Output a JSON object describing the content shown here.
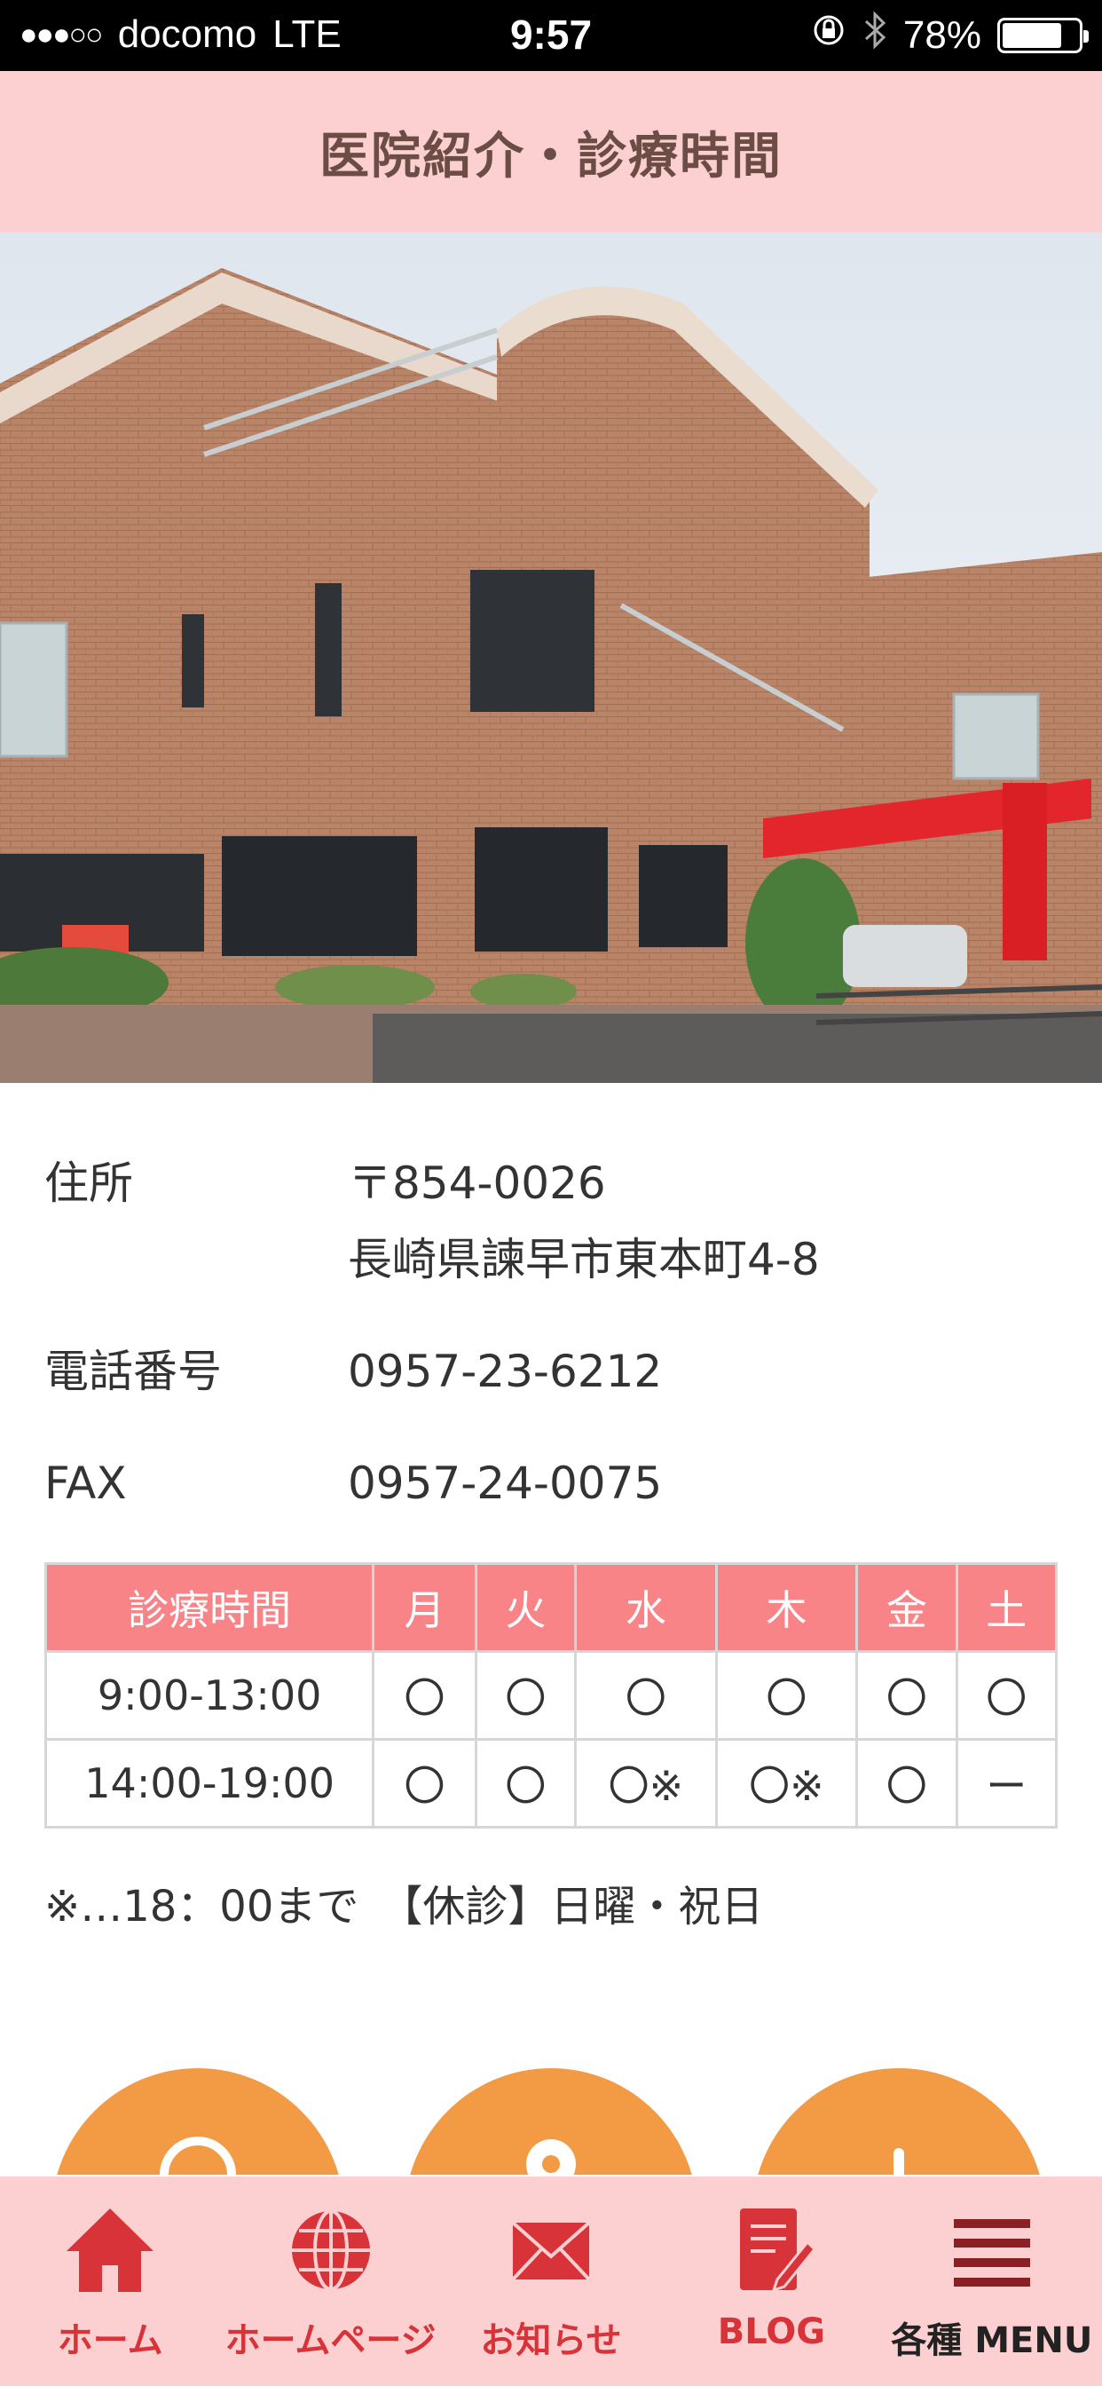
{
  "status_bar": {
    "signal_dots": "●●●○○",
    "carrier": "docomo",
    "network": "LTE",
    "time": "9:57",
    "battery_percent": "78%",
    "battery_level": 0.78
  },
  "header": {
    "title": "医院紹介・診療時間"
  },
  "photo": {
    "icon": "clinic-building-photo"
  },
  "info": {
    "address_label": "住所",
    "postal": "〒854-0026",
    "address": "長崎県諫早市東本町4-8",
    "phone_label": "電話番号",
    "phone": "0957-23-6212",
    "fax_label": "FAX",
    "fax": "0957-24-0075"
  },
  "hours_table": {
    "headers": [
      "診療時間",
      "月",
      "火",
      "水",
      "木",
      "金",
      "土"
    ],
    "rows": [
      [
        "9:00-13:00",
        "〇",
        "〇",
        "〇",
        "〇",
        "〇",
        "〇"
      ],
      [
        "14:00-19:00",
        "〇",
        "〇",
        "〇※",
        "〇※",
        "〇",
        "ー"
      ]
    ]
  },
  "note": "※…18：00まで　【休診】日曜・祝日",
  "colors": {
    "header_bg": "#fcd0d0",
    "table_header_bg": "#f88487",
    "accent_orange": "#f39a45",
    "tab_red": "#d9333a"
  },
  "tabbar": {
    "items": [
      {
        "label": "ホーム",
        "icon": "home-icon"
      },
      {
        "label": "ホームページ",
        "icon": "globe-icon"
      },
      {
        "label": "お知らせ",
        "icon": "mail-icon"
      },
      {
        "label": "BLOG",
        "icon": "blog-edit-icon"
      },
      {
        "label": "各種 MENU",
        "icon": "menu-icon"
      }
    ]
  }
}
